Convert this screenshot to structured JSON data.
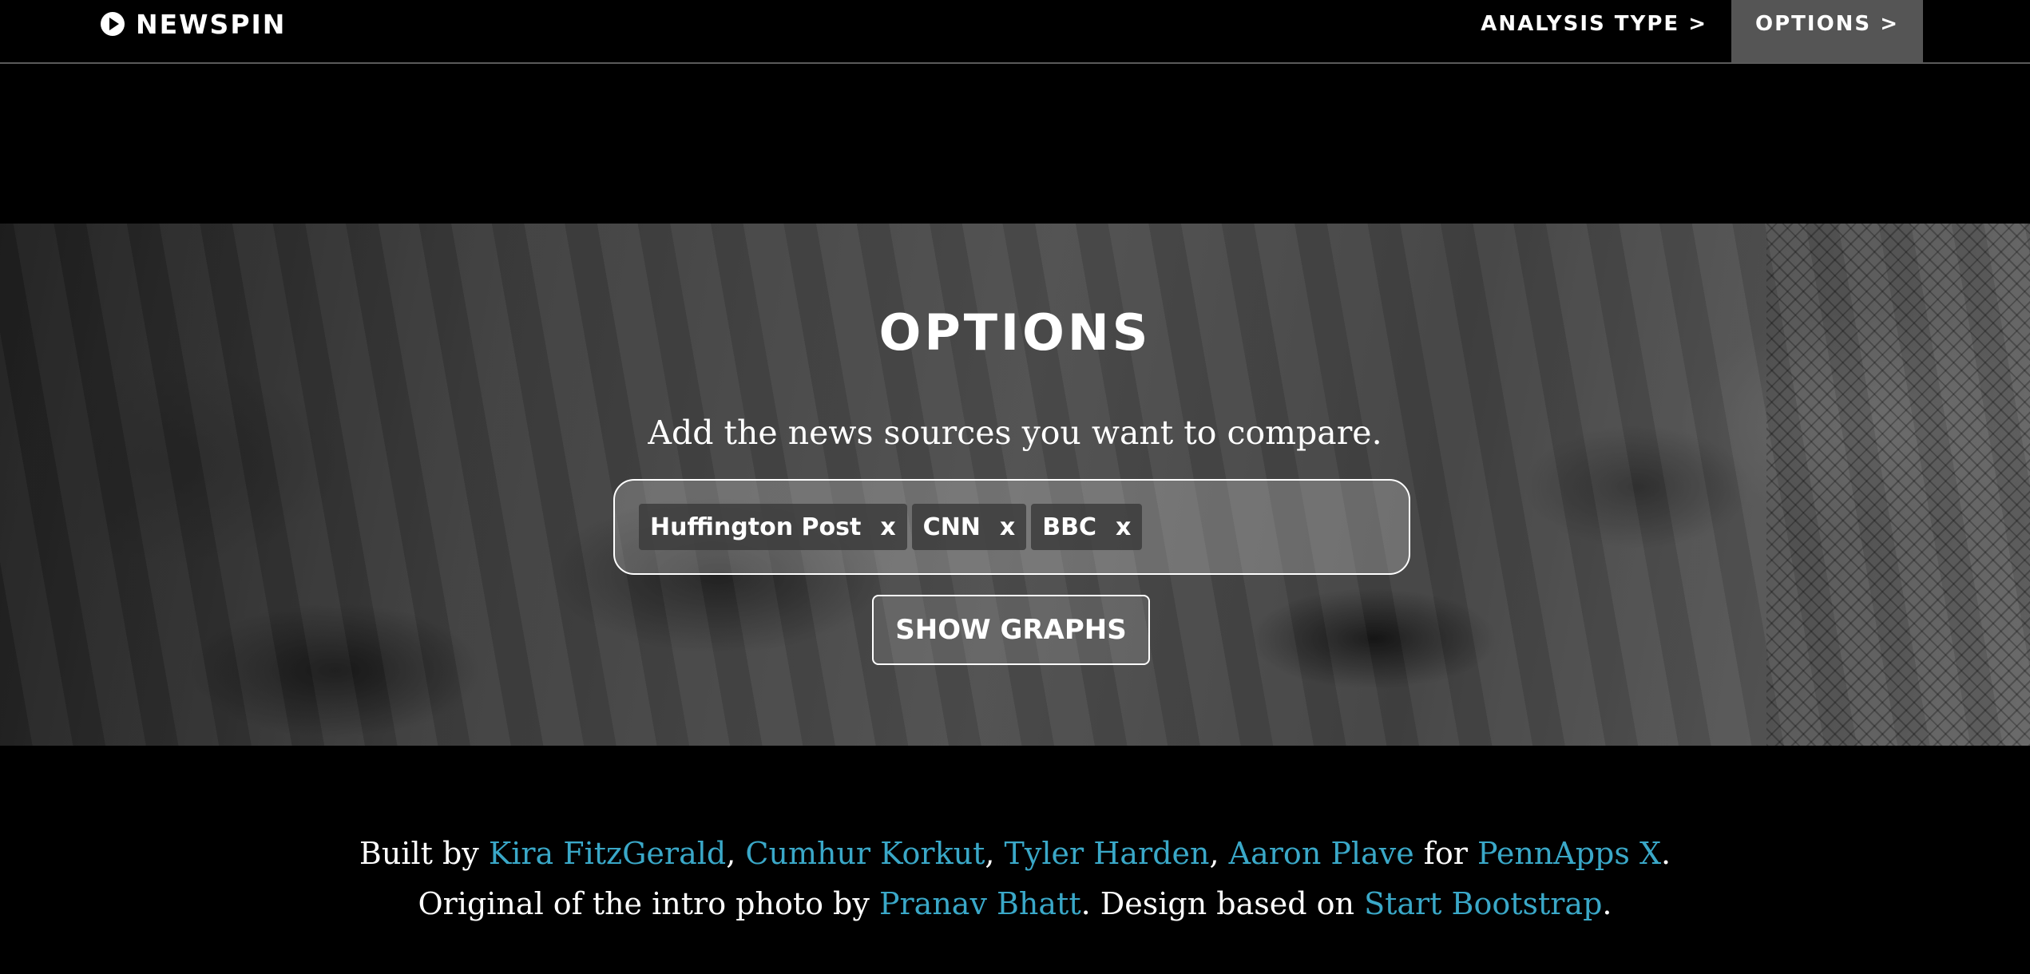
{
  "nav": {
    "brand": "NEWSPIN",
    "links": [
      {
        "label": "ANALYSIS TYPE >"
      },
      {
        "label": "OPTIONS >"
      }
    ]
  },
  "hero": {
    "title": "OPTIONS",
    "subtitle": "Add the news sources you want to compare.",
    "tags": [
      {
        "label": "Huffington Post",
        "remove": "x"
      },
      {
        "label": "CNN",
        "remove": "x"
      },
      {
        "label": "BBC",
        "remove": "x"
      }
    ],
    "button_label": "SHOW GRAPHS"
  },
  "footer": {
    "line1": {
      "prefix": "Built by ",
      "authors": [
        "Kira FitzGerald",
        "Cumhur Korkut",
        "Tyler Harden",
        "Aaron Plave"
      ],
      "sep": ", ",
      "for_text": " for ",
      "event": "PennApps X",
      "end": "."
    },
    "line2": {
      "prefix": "Original of the intro photo by ",
      "photographer": "Pranav Bhatt",
      "middle": ". Design based on ",
      "design_source": "Start Bootstrap",
      "end": "."
    }
  },
  "colors": {
    "link": "#3aa8c8",
    "active_nav_bg": "#555555"
  }
}
